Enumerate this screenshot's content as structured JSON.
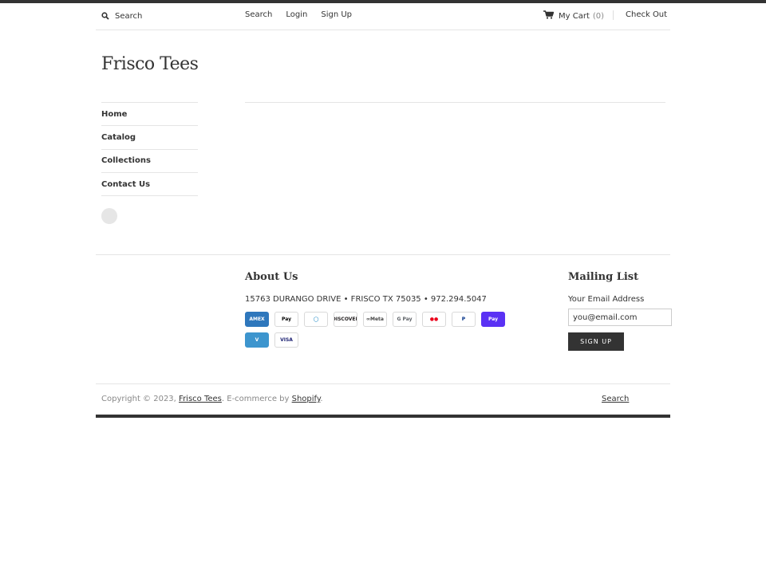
{
  "header": {
    "search_placeholder": "Search",
    "links": [
      "Search",
      "Login",
      "Sign Up"
    ],
    "cart_label": "My Cart",
    "cart_count": "(0)",
    "checkout_label": "Check Out"
  },
  "store": {
    "name": "Frisco Tees"
  },
  "sidebar": {
    "items": [
      {
        "label": "Home"
      },
      {
        "label": "Catalog"
      },
      {
        "label": "Collections"
      },
      {
        "label": "Contact Us"
      }
    ]
  },
  "footer": {
    "about_title": "About Us",
    "address": "15763 DURANGO DRIVE • FRISCO TX 75035 • 972.294.5047",
    "payment_methods": [
      {
        "name": "amex-icon",
        "label": "AMEX",
        "bg": "#2e77bc",
        "fg": "#ffffff"
      },
      {
        "name": "apple-pay-icon",
        "label": "Pay",
        "bg": "#ffffff",
        "fg": "#000000"
      },
      {
        "name": "diners-club-icon",
        "label": "◯",
        "bg": "#ffffff",
        "fg": "#0079be"
      },
      {
        "name": "discover-icon",
        "label": "DISCOVER",
        "bg": "#ffffff",
        "fg": "#231f20"
      },
      {
        "name": "meta-pay-icon",
        "label": "∞Meta",
        "bg": "#ffffff",
        "fg": "#444444"
      },
      {
        "name": "google-pay-icon",
        "label": "G Pay",
        "bg": "#ffffff",
        "fg": "#5f6368"
      },
      {
        "name": "mastercard-icon",
        "label": "●●",
        "bg": "#ffffff",
        "fg": "#eb001b"
      },
      {
        "name": "paypal-icon",
        "label": "P",
        "bg": "#ffffff",
        "fg": "#003087"
      },
      {
        "name": "shop-pay-icon",
        "label": "Pay",
        "bg": "#5a31f4",
        "fg": "#ffffff"
      },
      {
        "name": "venmo-icon",
        "label": "V",
        "bg": "#3d95ce",
        "fg": "#ffffff"
      },
      {
        "name": "visa-icon",
        "label": "VISA",
        "bg": "#ffffff",
        "fg": "#1a1f71"
      }
    ],
    "mailing_title": "Mailing List",
    "email_label": "Your Email Address",
    "email_placeholder": "you@email.com",
    "signup_button": "SIGN UP",
    "copyright_prefix": "Copyright © 2023,",
    "copyright_store": "Frisco Tees",
    "copyright_mid": ". E-commerce by",
    "copyright_platform": "Shopify",
    "copyright_suffix": ".",
    "search_link": "Search"
  }
}
